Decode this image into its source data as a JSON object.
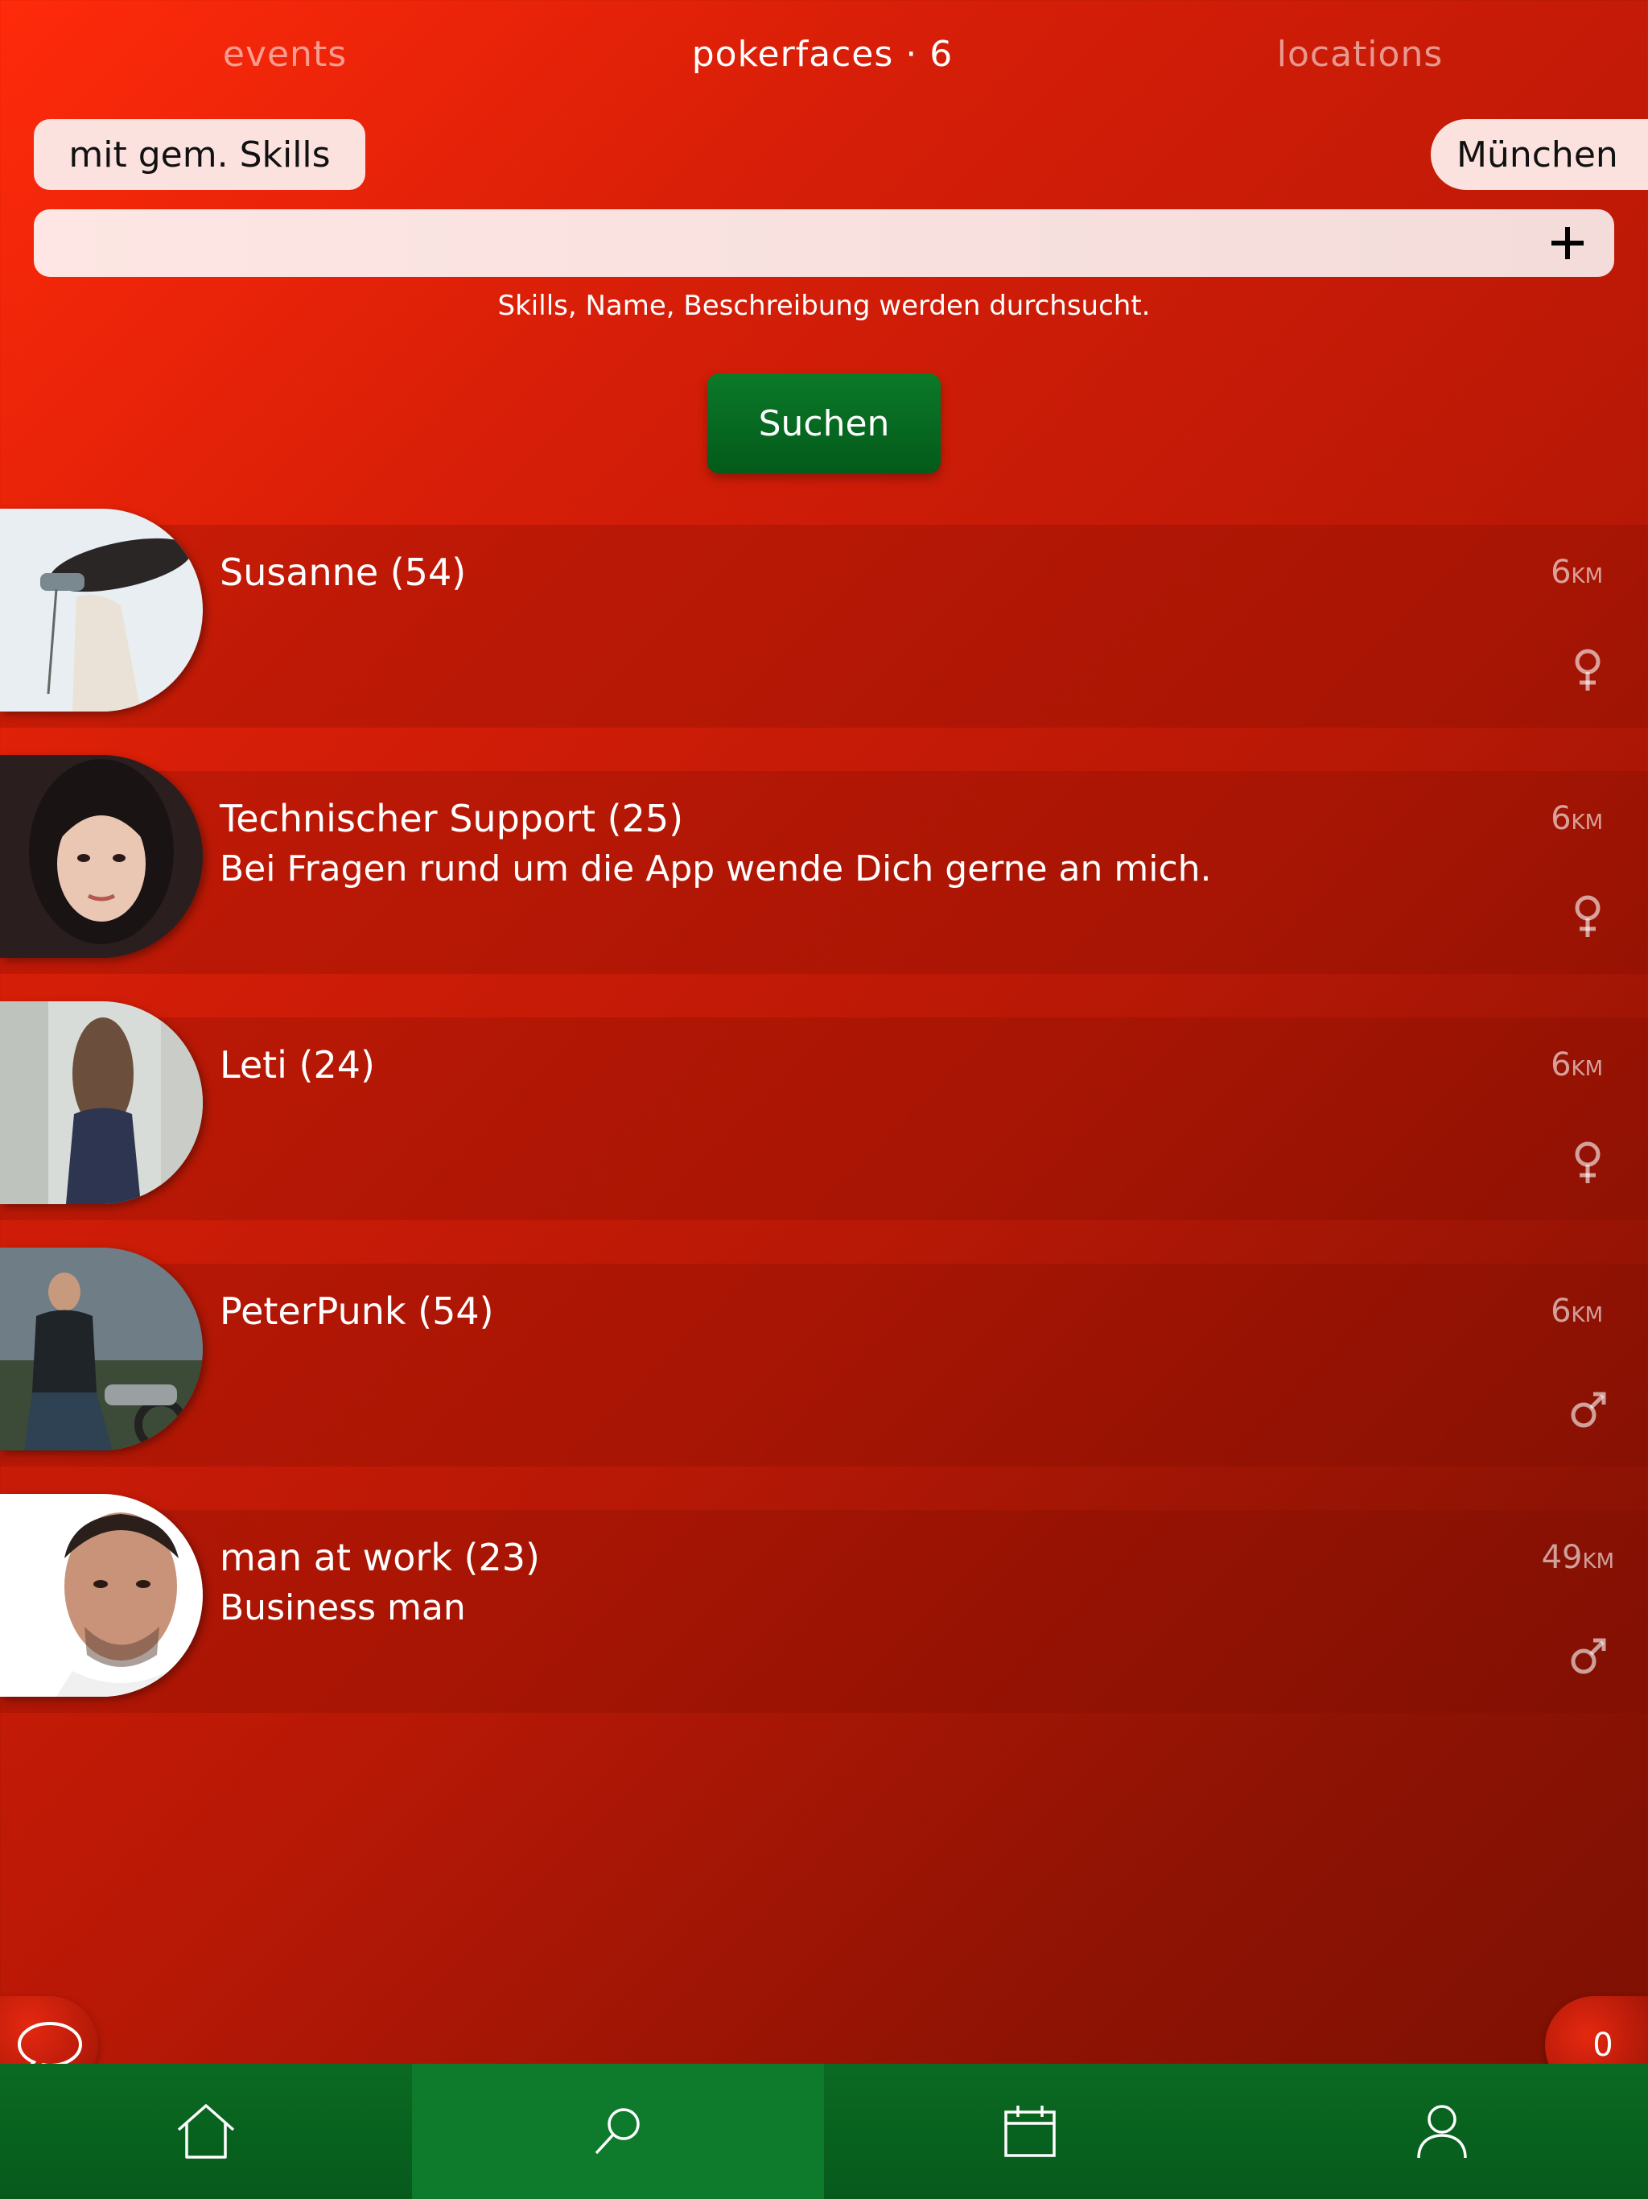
{
  "tabs": [
    {
      "label": "events"
    },
    {
      "label": "pokerfaces · 6"
    },
    {
      "label": "locations"
    }
  ],
  "filters": {
    "skills_label": "mit gem. Skills",
    "city_label": "München"
  },
  "search": {
    "value": "",
    "hint": "Skills, Name, Beschreibung werden durchsucht.",
    "button_label": "Suchen"
  },
  "results": [
    {
      "name": "Susanne (54)",
      "description": "",
      "distance": "6",
      "unit": "KM",
      "gender": "female"
    },
    {
      "name": "Technischer Support (25)",
      "description": "Bei Fragen rund um die App wende Dich gerne an mich.",
      "distance": "6",
      "unit": "KM",
      "gender": "female"
    },
    {
      "name": "Leti (24)",
      "description": "",
      "distance": "6",
      "unit": "KM",
      "gender": "female"
    },
    {
      "name": "PeterPunk (54)",
      "description": "",
      "distance": "6",
      "unit": "KM",
      "gender": "male"
    },
    {
      "name": "man at work (23)",
      "description": "Business man",
      "distance": "49",
      "unit": "KM",
      "gender": "male"
    }
  ],
  "floating": {
    "counter": "0"
  },
  "navbar": {
    "items": [
      "home-icon",
      "search-icon",
      "calendar-icon",
      "profile-icon"
    ],
    "active_index": 1
  },
  "colors": {
    "accent_red": "#e0230b",
    "nav_green": "#0a6a22",
    "button_green": "#0b7a28"
  }
}
